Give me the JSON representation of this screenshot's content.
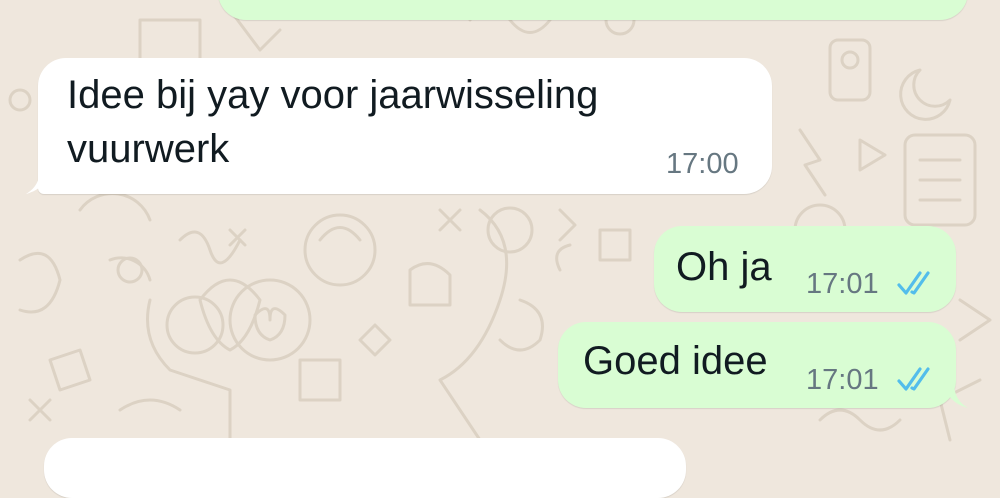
{
  "chat": {
    "messages": [
      {
        "direction": "incoming",
        "text_line1": "Idee bij yay voor jaarwisseling",
        "text_line2": "vuurwerk",
        "time": "17:00"
      },
      {
        "direction": "outgoing",
        "text": "Oh ja",
        "time": "17:01",
        "status": "read"
      },
      {
        "direction": "outgoing",
        "text": "Goed idee",
        "time": "17:01",
        "status": "read"
      }
    ]
  },
  "colors": {
    "wallpaper": "#efe7dd",
    "incoming_bubble": "#ffffff",
    "outgoing_bubble": "#d9fdd3",
    "read_ticks": "#53bdeb"
  },
  "icons": {
    "read_receipt": "double-check-icon"
  }
}
